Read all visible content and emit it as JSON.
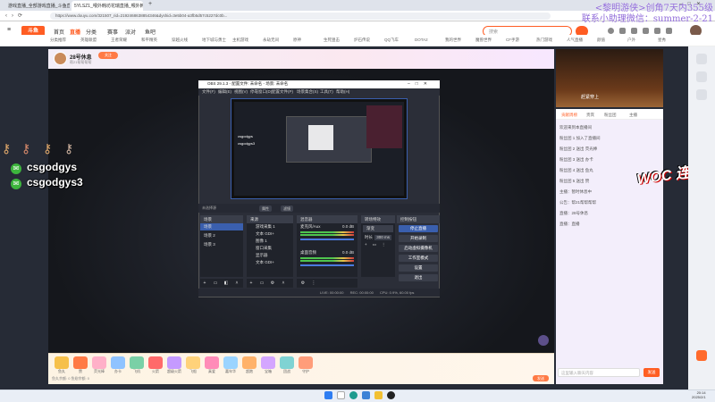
{
  "browser": {
    "tabs": [
      "游戏直播_全部游戏直播_斗鱼直播",
      "5YLSZ1_喂外韩坊花瑞直播_喂外韩...",
      ""
    ],
    "url": "https://www.douyu.com/321507_rid=2192468638854346&dyshid=3e5b04-a3fb5d57c5227dc0b..."
  },
  "site": {
    "logo": "斗鱼",
    "nav": [
      "首页",
      "直播",
      "分类",
      "赛事",
      "派对",
      "鱼吧"
    ],
    "search_placeholder": "搜索",
    "categories": [
      "分类推荐",
      "英雄联盟",
      "王者荣耀",
      "和平精英",
      "穿越火线",
      "地下城与勇士",
      "主机游戏",
      "永劫无间",
      "原神",
      "生死狙击",
      "炉石传说",
      "QQ飞车",
      "DOTA2",
      "我的世界",
      "魔兽世界",
      "CF手游",
      "热门游戏",
      "人气直播",
      "颜值",
      "户外",
      "星秀"
    ]
  },
  "room": {
    "title": "28号休息",
    "subtitle": "帮21帮帮帮帮",
    "follow": "关注",
    "gift_footer": "鱼丸余额: 0  鱼翅余额: 0",
    "send": "发送",
    "gifts": [
      "鱼丸",
      "赞",
      "荧光棒",
      "办卡",
      "飞机",
      "火箭",
      "超级火箭",
      "飞船",
      "真爱",
      "嘉年华",
      "超跑",
      "宝箱",
      "团战",
      "守护"
    ]
  },
  "obs": {
    "title": "OBS 29.1.3 - 配置文件: 未命名 - 场景: 未命名",
    "menus": [
      "文件(F)",
      "编辑(E)",
      "视图(V)",
      "停靠窗口(D)",
      "配置文件(P)",
      "场景集合(S)",
      "工具(T)",
      "帮助(H)"
    ],
    "scene_label": "未选择源",
    "toolbar": [
      "属性",
      "滤镜"
    ],
    "docks": {
      "scenes": {
        "title": "场景",
        "items": [
          "场景",
          "场景 2",
          "场景 3"
        ]
      },
      "sources": {
        "title": "来源",
        "items": [
          "游戏采集 1",
          "文本 GDI+",
          "图像 1",
          "窗口采集",
          "显示器",
          "文本 GDI+"
        ]
      },
      "mixer": {
        "title": "混音器",
        "channels": [
          {
            "name": "麦克风/Aux",
            "db": "0.0 dB"
          },
          {
            "name": "桌面音频",
            "db": "0.0 dB"
          }
        ]
      },
      "transitions": {
        "title": "转场特效",
        "mode": "渐变",
        "duration_label": "时长",
        "duration": "300 ms"
      },
      "controls": {
        "title": "控制按钮",
        "buttons": [
          "停止直播",
          "开始录制",
          "启动虚拟摄像机",
          "工作室模式",
          "设置",
          "退出"
        ]
      }
    },
    "status": {
      "live": "LIVE: 00:00:00",
      "rec": "REC: 00:00:00",
      "cpu": "CPU: 0.9%, 60.00 fps"
    },
    "nested_labels": [
      "csgodgys",
      "csgodgys3"
    ]
  },
  "overlay": {
    "wechat": [
      "csgodgys",
      "csgodgys3"
    ],
    "top_right": [
      "<黎明游侠>创角7天内355级",
      "联系小助理微信：summer-2-21"
    ]
  },
  "right": {
    "rank_title": "赶紧穿上",
    "chat_tabs": [
      "贡献周榜",
      "贵宾",
      "粉丝团",
      "主播"
    ],
    "chat_lines": [
      "欢迎来到本直播间",
      "粉丝团 1 加入了直播间",
      "粉丝团 2 送出 荧光棒",
      "粉丝团 3 送出 办卡",
      "粉丝团 4 送出 鱼丸",
      "粉丝团 5 送出 赞",
      "主播：暂时休息中",
      "公告：帮21帮帮帮帮",
      "直播：28号休息",
      "直播：直播"
    ],
    "chat_placeholder": "这里输入聊天内容",
    "chat_send": "发送",
    "woc": "WOC 连段"
  },
  "taskbar": {
    "time": "20:14",
    "date": "2025/2/1"
  }
}
